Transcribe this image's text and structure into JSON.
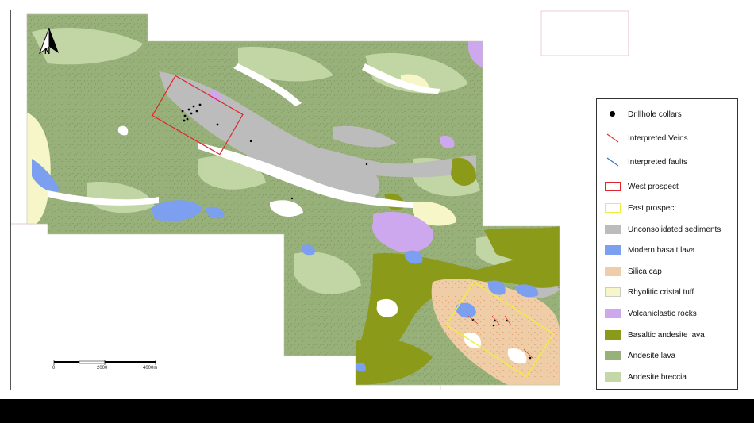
{
  "map": {
    "north_label": "N",
    "scale": {
      "labels": [
        "0",
        "2000",
        "4000m"
      ]
    },
    "legend": [
      {
        "label": "Drillhole collars",
        "kind": "dot",
        "color": "#000000"
      },
      {
        "label": "Interpreted Veins",
        "kind": "line",
        "color": "#e8322e"
      },
      {
        "label": "Interpreted faults",
        "kind": "line",
        "color": "#2f78d6"
      },
      {
        "label": "West prospect",
        "kind": "outline",
        "color": "#e0262a"
      },
      {
        "label": "East prospect",
        "kind": "outline",
        "color": "#f0ee3a"
      },
      {
        "label": "Unconsolidated sediments",
        "kind": "fill",
        "color": "#bcbcbc"
      },
      {
        "label": "Modern basalt lava",
        "kind": "fill",
        "color": "#7d9ff0"
      },
      {
        "label": "Silica cap",
        "kind": "fill",
        "color": "#efcda7"
      },
      {
        "label": "Rhyolitic cristal tuff",
        "kind": "fill",
        "color": "#f6f6c8"
      },
      {
        "label": "Volcaniclastic rocks",
        "kind": "fill",
        "color": "#cda8ee"
      },
      {
        "label": "Basaltic andesite lava",
        "kind": "fill",
        "color": "#8c9a1a"
      },
      {
        "label": "Andesite lava",
        "kind": "fill",
        "color": "#98b07a"
      },
      {
        "label": "Andesite breccia",
        "kind": "fill",
        "color": "#c3d8a6"
      }
    ]
  }
}
